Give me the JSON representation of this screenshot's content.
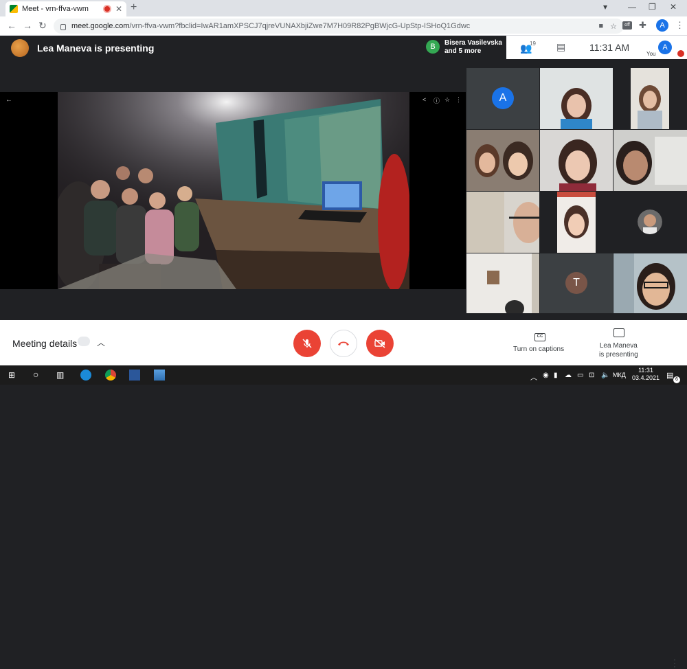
{
  "browser": {
    "tab_title": "Meet - vrn-ffva-vwm",
    "url_host": "meet.google.com",
    "url_path": "/vrn-ffva-vwm?fbclid=IwAR1amXPSCJ7qjreVUNAXbjiZwe7M7H09R82PgBWjcG-UpStp-ISHoQ1Gdwc",
    "ext_badge": "off",
    "profile_letter": "A",
    "new_tab_symbol": "+",
    "close_tab_symbol": "✕"
  },
  "meet": {
    "presenting_banner": "Lea Maneva is presenting",
    "active_speaker": {
      "letter": "B",
      "name_line1": "Bisera Vasilevska",
      "name_line2": "and 5 more"
    },
    "people_count": "19",
    "time": "11:31  AM",
    "you_letter": "A",
    "you_label": "You",
    "grid": [
      {
        "kind": "letter",
        "letter": "A",
        "color": "#1a73e8"
      },
      {
        "kind": "video"
      },
      {
        "kind": "video"
      },
      {
        "kind": "video"
      },
      {
        "kind": "video"
      },
      {
        "kind": "video"
      },
      {
        "kind": "video"
      },
      {
        "kind": "video"
      },
      {
        "kind": "video"
      },
      {
        "kind": "video"
      },
      {
        "kind": "letter",
        "letter": "T",
        "color": "#795548"
      },
      {
        "kind": "video"
      }
    ]
  },
  "controls": {
    "meeting_details": "Meeting details",
    "captions_label": "Turn on captions",
    "captions_icon_text": "CC",
    "presenting_line1": "Lea Maneva",
    "presenting_line2": "is presenting",
    "colors": {
      "danger": "#ea4335"
    }
  },
  "taskbar": {
    "lang": "МКД",
    "time": "11:31",
    "date": "03.4.2021",
    "notif_count": "6"
  }
}
